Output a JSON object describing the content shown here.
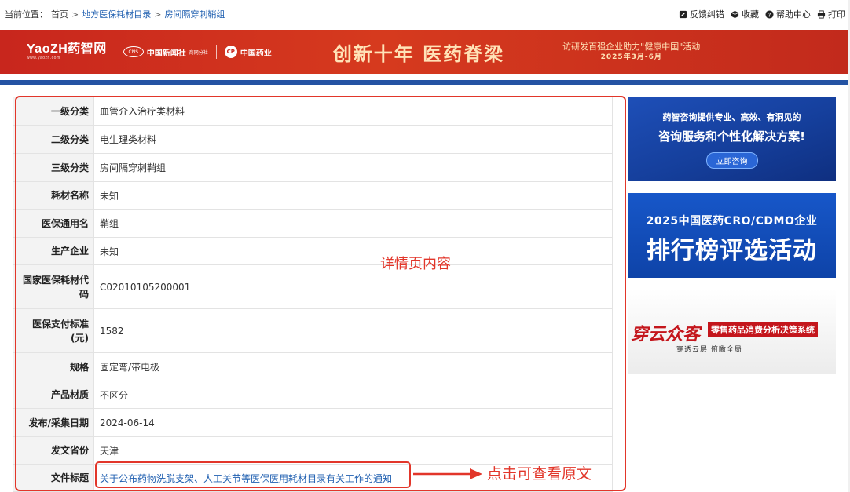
{
  "breadcrumb": {
    "prefix": "当前位置：",
    "items": [
      "首页",
      "地方医保耗材目录",
      "房间隔穿刺鞘组"
    ],
    "separator": ">"
  },
  "tools": {
    "feedback": "反馈纠错",
    "favorite": "收藏",
    "help": "帮助中心",
    "print": "打印"
  },
  "banner": {
    "logo1": "YaoZH药智网",
    "logo1_sub": "www.yaozh.com",
    "logo2": "中国新闻社",
    "logo2_ring": "CNS",
    "logo2_sub": "商网分社",
    "logo3": "中国药业",
    "logo3_mark": "CP",
    "slogan": "创新十年 医药脊梁",
    "activity_line1": "访研发百强企业助力\"健康中国\"活动",
    "activity_line2": "2025年3月-6月",
    "accent_color": "#c8261d"
  },
  "detail": {
    "rows": [
      {
        "label": "一级分类",
        "value": "血管介入治疗类材料"
      },
      {
        "label": "二级分类",
        "value": "电生理类材料"
      },
      {
        "label": "三级分类",
        "value": "房间隔穿刺鞘组"
      },
      {
        "label": "耗材名称",
        "value": "未知"
      },
      {
        "label": "医保通用名",
        "value": "鞘组"
      },
      {
        "label": "生产企业",
        "value": "未知"
      },
      {
        "label": "国家医保耗材代码",
        "value": "C02010105200001"
      },
      {
        "label": "医保支付标准(元)",
        "value": "1582"
      },
      {
        "label": "规格",
        "value": "固定弯/带电极"
      },
      {
        "label": "产品材质",
        "value": "不区分"
      },
      {
        "label": "发布/采集日期",
        "value": "2024-06-14"
      },
      {
        "label": "发文省份",
        "value": "天津"
      },
      {
        "label": "文件标题",
        "value": "关于公布药物洗脱支架、人工关节等医保医用耗材目录有关工作的通知"
      }
    ]
  },
  "annotations": {
    "detail_note": "详情页内容",
    "link_note": "点击可查看原文",
    "highlight_color": "#e2362a"
  },
  "ads": {
    "ad1_line1": "药智咨询提供专业、高效、有洞见的",
    "ad1_line2": "咨询服务和个性化解决方案!",
    "ad1_button": "立即咨询",
    "ad2_line1": "2025中国医药CRO/CDMO企业",
    "ad2_line2": "排行榜评选活动",
    "ad3_brand": "穿云众客",
    "ad3_tag": "零售药品消费分析决策系统",
    "ad3_sub": "穿透云层  俯瞰全局"
  }
}
